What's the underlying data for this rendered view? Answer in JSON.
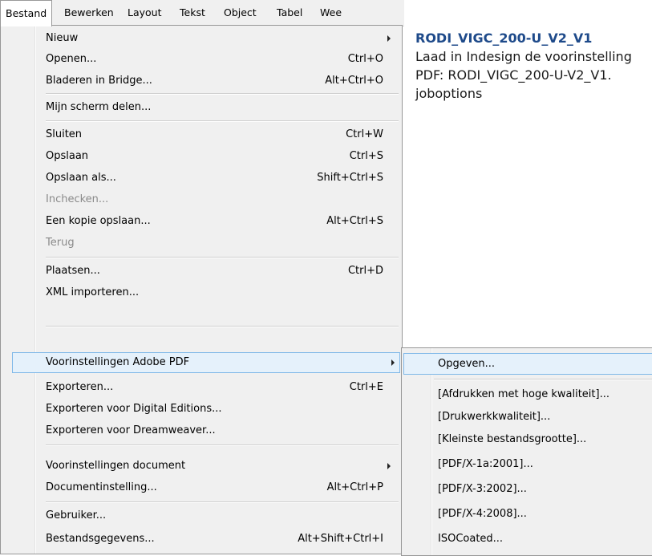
{
  "menubar": {
    "items": [
      "Bestand",
      "Bewerken",
      "Layout",
      "Tekst",
      "Object",
      "Tabel",
      "Wee"
    ]
  },
  "menu": {
    "items": [
      {
        "label": "Nieuw",
        "shortcut": "",
        "submenu": true
      },
      {
        "label": "Openen...",
        "shortcut": "Ctrl+O"
      },
      {
        "label": "Bladeren in Bridge...",
        "shortcut": "Alt+Ctrl+O"
      },
      {
        "label": "Mijn scherm delen...",
        "shortcut": ""
      },
      {
        "label": "Sluiten",
        "shortcut": "Ctrl+W"
      },
      {
        "label": "Opslaan",
        "shortcut": "Ctrl+S"
      },
      {
        "label": "Opslaan als...",
        "shortcut": "Shift+Ctrl+S"
      },
      {
        "label": "Inchecken...",
        "shortcut": "",
        "disabled": true
      },
      {
        "label": "Een kopie opslaan...",
        "shortcut": "Alt+Ctrl+S"
      },
      {
        "label": "Terug",
        "shortcut": "",
        "disabled": true
      },
      {
        "label": "Plaatsen...",
        "shortcut": "Ctrl+D"
      },
      {
        "label": "XML importeren...",
        "shortcut": ""
      },
      {
        "label": "Voorinstellingen Adobe PDF",
        "shortcut": "",
        "submenu": true,
        "highlighted": true
      },
      {
        "label": "Exporteren...",
        "shortcut": "Ctrl+E"
      },
      {
        "label": "Exporteren voor Digital Editions...",
        "shortcut": ""
      },
      {
        "label": "Exporteren voor Dreamweaver...",
        "shortcut": ""
      },
      {
        "label": "Voorinstellingen document",
        "shortcut": "",
        "submenu": true
      },
      {
        "label": "Documentinstelling...",
        "shortcut": "Alt+Ctrl+P"
      },
      {
        "label": "Gebruiker...",
        "shortcut": ""
      },
      {
        "label": "Bestandsgegevens...",
        "shortcut": "Alt+Shift+Ctrl+I"
      }
    ]
  },
  "submenu": {
    "items": [
      {
        "label": "Opgeven...",
        "highlighted": true
      },
      {
        "label": "[Afdrukken met hoge kwaliteit]..."
      },
      {
        "label": "[Drukwerkkwaliteit]..."
      },
      {
        "label": "[Kleinste bestandsgrootte]..."
      },
      {
        "label": "[PDF/X-1a:2001]..."
      },
      {
        "label": "[PDF/X-3:2002]..."
      },
      {
        "label": "[PDF/X-4:2008]..."
      },
      {
        "label": "ISOCoated..."
      }
    ]
  },
  "note": {
    "title": "RODI_VIGC_200-U_V2_V1",
    "body": "Laad in Indesign de voorinstelling PDF: RODI_VIGC_200-U-V2_V1. joboptions"
  },
  "colors": {
    "highlight_bg": "#e5f1fb",
    "highlight_border": "#7fb8e8",
    "note_title": "#1e4a8a",
    "disabled_text": "#8a8a8a"
  }
}
